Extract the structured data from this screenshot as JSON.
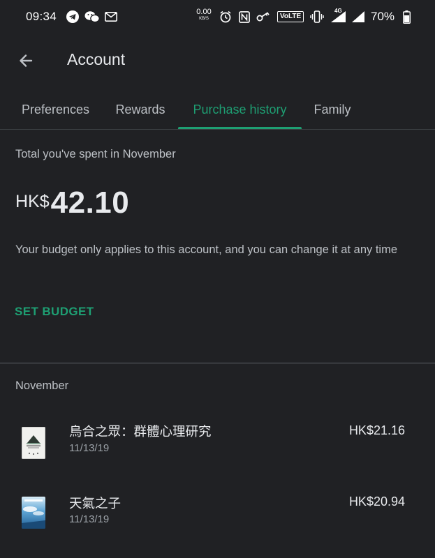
{
  "status_bar": {
    "time": "09:34",
    "net_speed_value": "0.00",
    "net_speed_unit": "KB/S",
    "network_badge": "VoLTE",
    "signal_tag": "4G",
    "battery": "70%",
    "left_icons": [
      "telegram-icon",
      "wechat-icon",
      "gmail-icon"
    ],
    "right_icons": [
      "alarm-icon",
      "nfc-icon",
      "key-icon",
      "vibrate-icon",
      "signal-4g-icon",
      "signal-icon",
      "battery-icon"
    ]
  },
  "header": {
    "title": "Account",
    "back_icon": "arrow-back-icon"
  },
  "tabs": [
    {
      "label": "Preferences",
      "active": false
    },
    {
      "label": "Rewards",
      "active": false
    },
    {
      "label": "Purchase history",
      "active": true
    },
    {
      "label": "Family",
      "active": false
    }
  ],
  "spending": {
    "label": "Total you've spent in November",
    "currency": "HK$",
    "amount": "42.10",
    "budget_note": "Your budget only applies to this account, and you can change it at any time",
    "set_budget_label": "SET BUDGET"
  },
  "history": {
    "month": "November",
    "items": [
      {
        "title": "烏合之眾：群體心理研究",
        "date": "11/13/19",
        "price": "HK$21.16",
        "thumb": "book-cover-thumbnail"
      },
      {
        "title": "天氣之子",
        "date": "11/13/19",
        "price": "HK$20.94",
        "thumb": "book-cover-thumbnail"
      }
    ]
  },
  "colors": {
    "background": "#202124",
    "accent": "#1e9f73",
    "text_primary": "#e8eaed",
    "text_secondary": "#bdc1c6"
  }
}
